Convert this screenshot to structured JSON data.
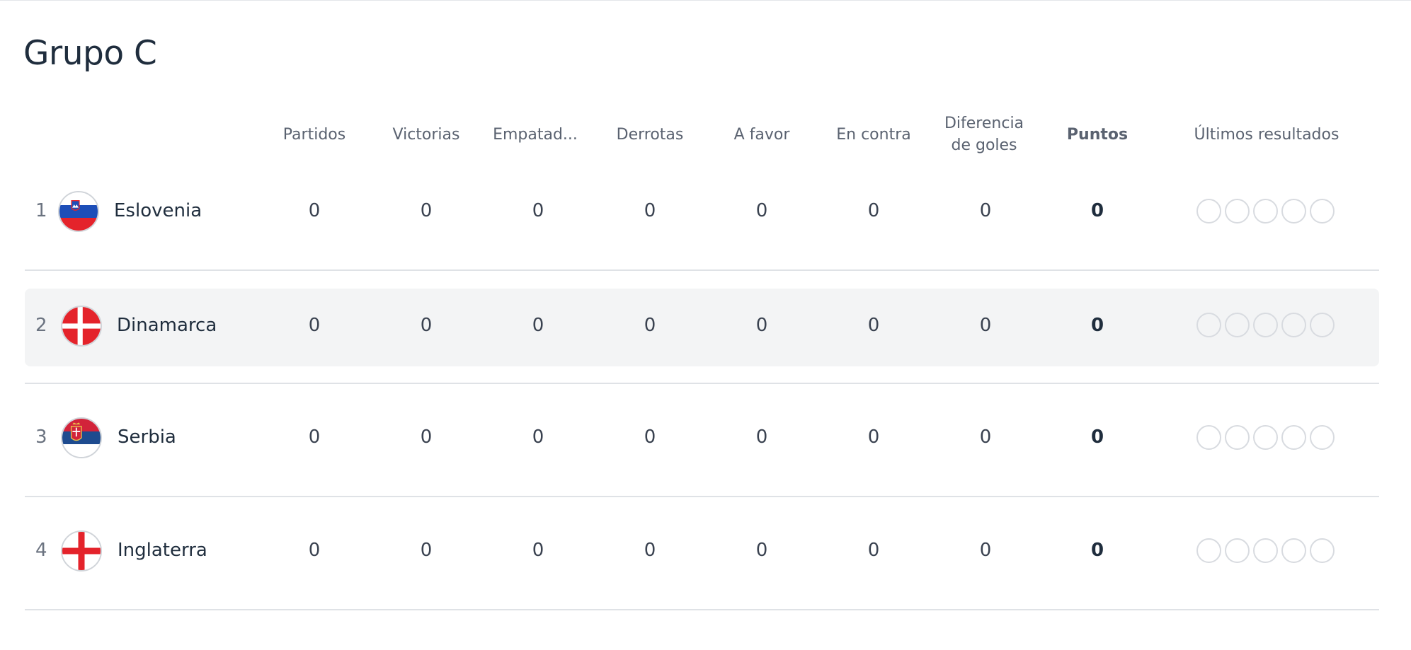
{
  "group_title": "Grupo C",
  "columns": {
    "played": "Partidos",
    "won": "Victorias",
    "drawn": "Empatad...",
    "lost": "Derrotas",
    "goals_for": "A favor",
    "goals_against": "En contra",
    "goal_diff": "Diferencia de goles",
    "points": "Puntos",
    "last_results": "Últimos resultados"
  },
  "teams": [
    {
      "pos": "1",
      "name": "Eslovenia",
      "flag_icon": "slovenia-flag-icon",
      "played": "0",
      "won": "0",
      "drawn": "0",
      "lost": "0",
      "goals_for": "0",
      "goals_against": "0",
      "goal_diff": "0",
      "points": "0"
    },
    {
      "pos": "2",
      "name": "Dinamarca",
      "flag_icon": "denmark-flag-icon",
      "played": "0",
      "won": "0",
      "drawn": "0",
      "lost": "0",
      "goals_for": "0",
      "goals_against": "0",
      "goal_diff": "0",
      "points": "0"
    },
    {
      "pos": "3",
      "name": "Serbia",
      "flag_icon": "serbia-flag-icon",
      "played": "0",
      "won": "0",
      "drawn": "0",
      "lost": "0",
      "goals_for": "0",
      "goals_against": "0",
      "goal_diff": "0",
      "points": "0"
    },
    {
      "pos": "4",
      "name": "Inglaterra",
      "flag_icon": "england-flag-icon",
      "played": "0",
      "won": "0",
      "drawn": "0",
      "lost": "0",
      "goals_for": "0",
      "goals_against": "0",
      "goal_diff": "0",
      "points": "0"
    }
  ],
  "colors": {
    "text_primary": "#1f2d3d",
    "text_secondary": "#5a6270",
    "highlight_row": "#f3f4f5",
    "divider": "#dfe2e6"
  }
}
